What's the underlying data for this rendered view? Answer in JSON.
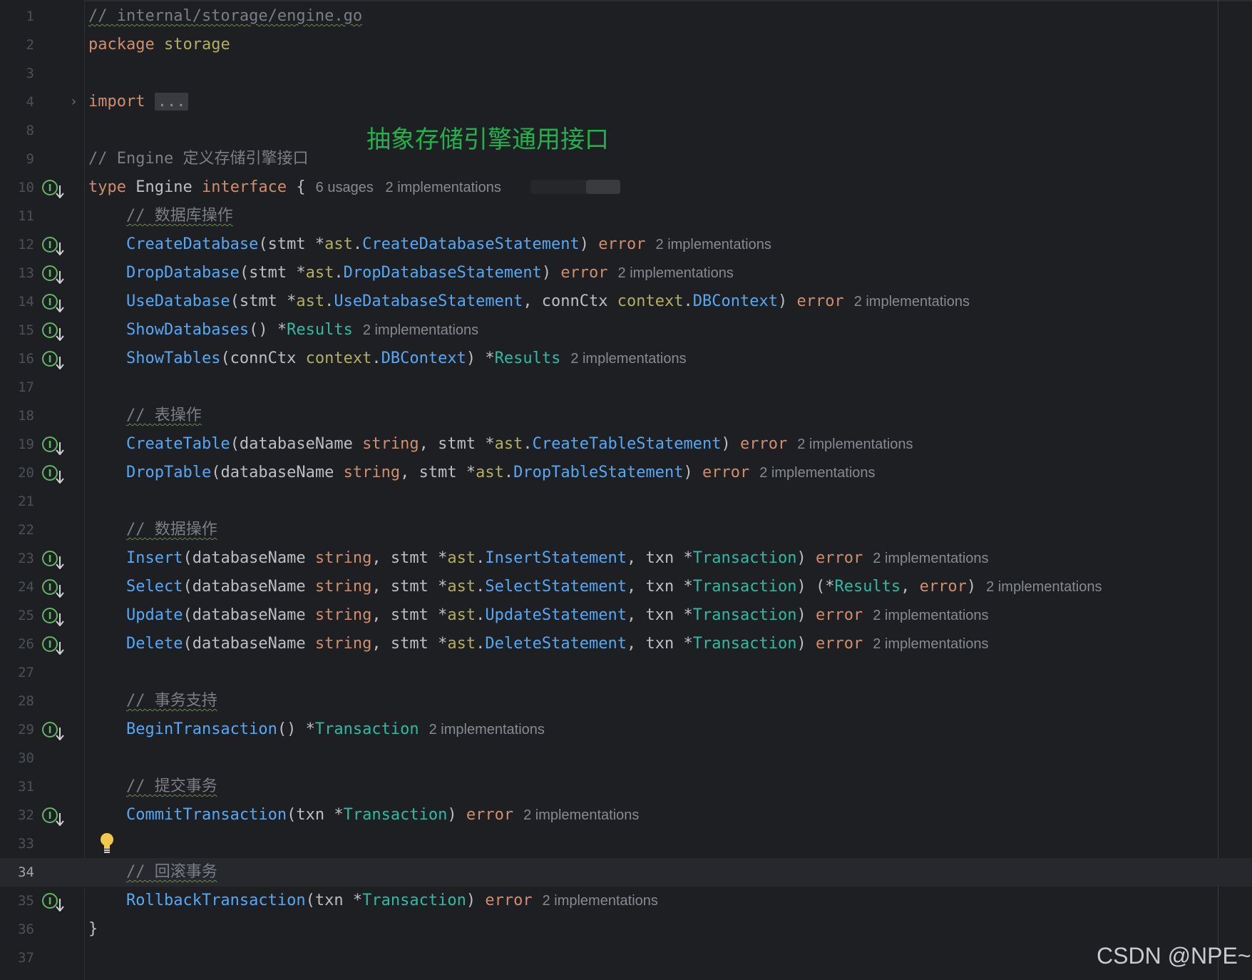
{
  "annotation": "抽象存储引擎通用接口",
  "watermark": "CSDN @NPE~",
  "folded_placeholder": "...",
  "lines": [
    {
      "n": "1",
      "tokens": [
        [
          "cm-u",
          "// internal/storage/engine.go"
        ]
      ]
    },
    {
      "n": "2",
      "tokens": [
        [
          "kw",
          "package"
        ],
        [
          "pl",
          " "
        ],
        [
          "pk",
          "storage"
        ]
      ]
    },
    {
      "n": "3",
      "tokens": []
    },
    {
      "n": "4",
      "tokens": [
        [
          "kw",
          "import"
        ],
        [
          "pl",
          " "
        ],
        [
          "fold",
          "..."
        ]
      ]
    },
    {
      "n": "8",
      "tokens": []
    },
    {
      "n": "9",
      "tokens": [
        [
          "cm",
          "// Engine 定义存储引擎接口"
        ]
      ]
    },
    {
      "n": "10",
      "impl": true,
      "tokens": [
        [
          "kw",
          "type"
        ],
        [
          "pl",
          " Engine "
        ],
        [
          "kw",
          "interface"
        ],
        [
          "pl",
          " {"
        ]
      ],
      "hint": "6 usages   2 implementations"
    },
    {
      "n": "11",
      "tokens": [
        [
          "pl",
          "    "
        ],
        [
          "cm-u",
          "// 数据库操作"
        ]
      ]
    },
    {
      "n": "12",
      "impl": true,
      "tokens": [
        [
          "pl",
          "    "
        ],
        [
          "fn",
          "CreateDatabase"
        ],
        [
          "pl",
          "(stmt *"
        ],
        [
          "pk",
          "ast"
        ],
        [
          "pl",
          "."
        ],
        [
          "fn",
          "CreateDatabaseStatement"
        ],
        [
          "pl",
          ") "
        ],
        [
          "kw",
          "error"
        ]
      ],
      "hint": "2 implementations"
    },
    {
      "n": "13",
      "impl": true,
      "tokens": [
        [
          "pl",
          "    "
        ],
        [
          "fn",
          "DropDatabase"
        ],
        [
          "pl",
          "(stmt *"
        ],
        [
          "pk",
          "ast"
        ],
        [
          "pl",
          "."
        ],
        [
          "fn",
          "DropDatabaseStatement"
        ],
        [
          "pl",
          ") "
        ],
        [
          "kw",
          "error"
        ]
      ],
      "hint": "2 implementations"
    },
    {
      "n": "14",
      "impl": true,
      "tokens": [
        [
          "pl",
          "    "
        ],
        [
          "fn",
          "UseDatabase"
        ],
        [
          "pl",
          "(stmt *"
        ],
        [
          "pk",
          "ast"
        ],
        [
          "pl",
          "."
        ],
        [
          "fn",
          "UseDatabaseStatement"
        ],
        [
          "pl",
          ", connCtx "
        ],
        [
          "pk",
          "context"
        ],
        [
          "pl",
          "."
        ],
        [
          "fn",
          "DBContext"
        ],
        [
          "pl",
          ") "
        ],
        [
          "kw",
          "error"
        ]
      ],
      "hint": "2 implementations"
    },
    {
      "n": "15",
      "impl": true,
      "tokens": [
        [
          "pl",
          "    "
        ],
        [
          "fn",
          "ShowDatabases"
        ],
        [
          "pl",
          "() *"
        ],
        [
          "ty",
          "Results"
        ]
      ],
      "hint": "2 implementations"
    },
    {
      "n": "16",
      "impl": true,
      "tokens": [
        [
          "pl",
          "    "
        ],
        [
          "fn",
          "ShowTables"
        ],
        [
          "pl",
          "(connCtx "
        ],
        [
          "pk",
          "context"
        ],
        [
          "pl",
          "."
        ],
        [
          "fn",
          "DBContext"
        ],
        [
          "pl",
          ") *"
        ],
        [
          "ty",
          "Results"
        ]
      ],
      "hint": "2 implementations"
    },
    {
      "n": "17",
      "tokens": []
    },
    {
      "n": "18",
      "tokens": [
        [
          "pl",
          "    "
        ],
        [
          "cm-u",
          "// 表操作"
        ]
      ]
    },
    {
      "n": "19",
      "impl": true,
      "tokens": [
        [
          "pl",
          "    "
        ],
        [
          "fn",
          "CreateTable"
        ],
        [
          "pl",
          "(databaseName "
        ],
        [
          "kw",
          "string"
        ],
        [
          "pl",
          ", stmt *"
        ],
        [
          "pk",
          "ast"
        ],
        [
          "pl",
          "."
        ],
        [
          "fn",
          "CreateTableStatement"
        ],
        [
          "pl",
          ") "
        ],
        [
          "kw",
          "error"
        ]
      ],
      "hint": "2 implementations"
    },
    {
      "n": "20",
      "impl": true,
      "tokens": [
        [
          "pl",
          "    "
        ],
        [
          "fn",
          "DropTable"
        ],
        [
          "pl",
          "(databaseName "
        ],
        [
          "kw",
          "string"
        ],
        [
          "pl",
          ", stmt *"
        ],
        [
          "pk",
          "ast"
        ],
        [
          "pl",
          "."
        ],
        [
          "fn",
          "DropTableStatement"
        ],
        [
          "pl",
          ") "
        ],
        [
          "kw",
          "error"
        ]
      ],
      "hint": "2 implementations"
    },
    {
      "n": "21",
      "tokens": []
    },
    {
      "n": "22",
      "tokens": [
        [
          "pl",
          "    "
        ],
        [
          "cm-u",
          "// 数据操作"
        ]
      ]
    },
    {
      "n": "23",
      "impl": true,
      "tokens": [
        [
          "pl",
          "    "
        ],
        [
          "fn",
          "Insert"
        ],
        [
          "pl",
          "(databaseName "
        ],
        [
          "kw",
          "string"
        ],
        [
          "pl",
          ", stmt *"
        ],
        [
          "pk",
          "ast"
        ],
        [
          "pl",
          "."
        ],
        [
          "fn",
          "InsertStatement"
        ],
        [
          "pl",
          ", txn *"
        ],
        [
          "ty",
          "Transaction"
        ],
        [
          "pl",
          ") "
        ],
        [
          "kw",
          "error"
        ]
      ],
      "hint": "2 implementations"
    },
    {
      "n": "24",
      "impl": true,
      "tokens": [
        [
          "pl",
          "    "
        ],
        [
          "fn",
          "Select"
        ],
        [
          "pl",
          "(databaseName "
        ],
        [
          "kw",
          "string"
        ],
        [
          "pl",
          ", stmt *"
        ],
        [
          "pk",
          "ast"
        ],
        [
          "pl",
          "."
        ],
        [
          "fn",
          "SelectStatement"
        ],
        [
          "pl",
          ", txn *"
        ],
        [
          "ty",
          "Transaction"
        ],
        [
          "pl",
          ") (*"
        ],
        [
          "ty",
          "Results"
        ],
        [
          "pl",
          ", "
        ],
        [
          "kw",
          "error"
        ],
        [
          "pl",
          ")"
        ]
      ],
      "hint": "2 implementations"
    },
    {
      "n": "25",
      "impl": true,
      "tokens": [
        [
          "pl",
          "    "
        ],
        [
          "fn",
          "Update"
        ],
        [
          "pl",
          "(databaseName "
        ],
        [
          "kw",
          "string"
        ],
        [
          "pl",
          ", stmt *"
        ],
        [
          "pk",
          "ast"
        ],
        [
          "pl",
          "."
        ],
        [
          "fn",
          "UpdateStatement"
        ],
        [
          "pl",
          ", txn *"
        ],
        [
          "ty",
          "Transaction"
        ],
        [
          "pl",
          ") "
        ],
        [
          "kw",
          "error"
        ]
      ],
      "hint": "2 implementations"
    },
    {
      "n": "26",
      "impl": true,
      "tokens": [
        [
          "pl",
          "    "
        ],
        [
          "fn",
          "Delete"
        ],
        [
          "pl",
          "(databaseName "
        ],
        [
          "kw",
          "string"
        ],
        [
          "pl",
          ", stmt *"
        ],
        [
          "pk",
          "ast"
        ],
        [
          "pl",
          "."
        ],
        [
          "fn",
          "DeleteStatement"
        ],
        [
          "pl",
          ", txn *"
        ],
        [
          "ty",
          "Transaction"
        ],
        [
          "pl",
          ") "
        ],
        [
          "kw",
          "error"
        ]
      ],
      "hint": "2 implementations"
    },
    {
      "n": "27",
      "tokens": []
    },
    {
      "n": "28",
      "tokens": [
        [
          "pl",
          "    "
        ],
        [
          "cm-u",
          "// 事务支持"
        ]
      ]
    },
    {
      "n": "29",
      "impl": true,
      "tokens": [
        [
          "pl",
          "    "
        ],
        [
          "fn",
          "BeginTransaction"
        ],
        [
          "pl",
          "() *"
        ],
        [
          "ty",
          "Transaction"
        ]
      ],
      "hint": "2 implementations"
    },
    {
      "n": "30",
      "tokens": []
    },
    {
      "n": "31",
      "tokens": [
        [
          "pl",
          "    "
        ],
        [
          "cm-u",
          "// 提交事务"
        ]
      ]
    },
    {
      "n": "32",
      "impl": true,
      "tokens": [
        [
          "pl",
          "    "
        ],
        [
          "fn",
          "CommitTransaction"
        ],
        [
          "pl",
          "(txn *"
        ],
        [
          "ty",
          "Transaction"
        ],
        [
          "pl",
          ") "
        ],
        [
          "kw",
          "error"
        ]
      ],
      "hint": "2 implementations"
    },
    {
      "n": "33",
      "bulb": true,
      "tokens": []
    },
    {
      "n": "34",
      "current": true,
      "tokens": [
        [
          "pl",
          "    "
        ],
        [
          "cm-u",
          "// 回滚事务"
        ]
      ]
    },
    {
      "n": "35",
      "impl": true,
      "tokens": [
        [
          "pl",
          "    "
        ],
        [
          "fn",
          "RollbackTransaction"
        ],
        [
          "pl",
          "(txn *"
        ],
        [
          "ty",
          "Transaction"
        ],
        [
          "pl",
          ") "
        ],
        [
          "kw",
          "error"
        ]
      ],
      "hint": "2 implementations"
    },
    {
      "n": "36",
      "tokens": [
        [
          "pl",
          "}"
        ]
      ]
    },
    {
      "n": "37",
      "tokens": []
    }
  ]
}
